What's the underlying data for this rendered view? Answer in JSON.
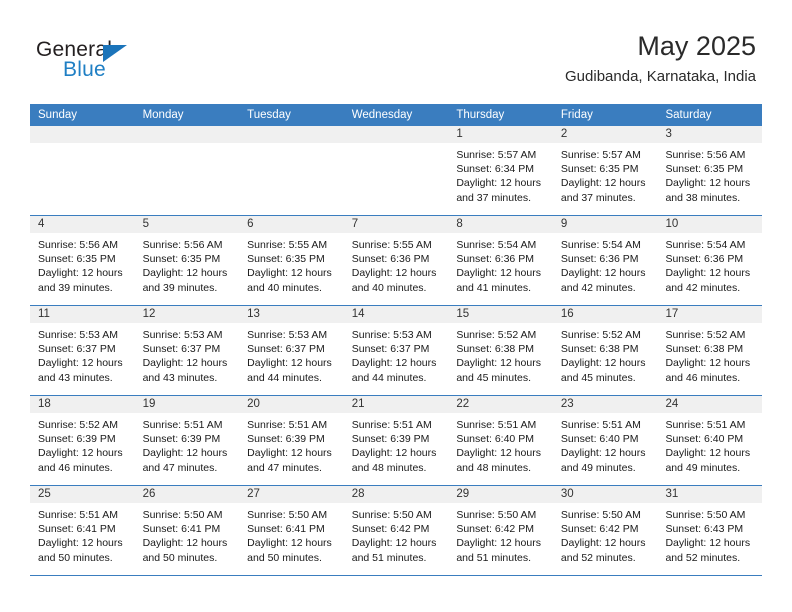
{
  "brand": {
    "name_top": "General",
    "name_bottom": "Blue",
    "accent_color": "#1b74ba",
    "logo_icon": "triangle-logo-icon"
  },
  "header": {
    "title": "May 2025",
    "subtitle": "Gudibanda, Karnataka, India"
  },
  "calendar": {
    "header_bg": "#3a7dbf",
    "day_band_bg": "#f0f0f0",
    "weekdays": [
      "Sunday",
      "Monday",
      "Tuesday",
      "Wednesday",
      "Thursday",
      "Friday",
      "Saturday"
    ],
    "weeks": [
      [
        {
          "day": "",
          "lines": []
        },
        {
          "day": "",
          "lines": []
        },
        {
          "day": "",
          "lines": []
        },
        {
          "day": "",
          "lines": []
        },
        {
          "day": "1",
          "lines": [
            "Sunrise: 5:57 AM",
            "Sunset: 6:34 PM",
            "Daylight: 12 hours",
            "and 37 minutes."
          ]
        },
        {
          "day": "2",
          "lines": [
            "Sunrise: 5:57 AM",
            "Sunset: 6:35 PM",
            "Daylight: 12 hours",
            "and 37 minutes."
          ]
        },
        {
          "day": "3",
          "lines": [
            "Sunrise: 5:56 AM",
            "Sunset: 6:35 PM",
            "Daylight: 12 hours",
            "and 38 minutes."
          ]
        }
      ],
      [
        {
          "day": "4",
          "lines": [
            "Sunrise: 5:56 AM",
            "Sunset: 6:35 PM",
            "Daylight: 12 hours",
            "and 39 minutes."
          ]
        },
        {
          "day": "5",
          "lines": [
            "Sunrise: 5:56 AM",
            "Sunset: 6:35 PM",
            "Daylight: 12 hours",
            "and 39 minutes."
          ]
        },
        {
          "day": "6",
          "lines": [
            "Sunrise: 5:55 AM",
            "Sunset: 6:35 PM",
            "Daylight: 12 hours",
            "and 40 minutes."
          ]
        },
        {
          "day": "7",
          "lines": [
            "Sunrise: 5:55 AM",
            "Sunset: 6:36 PM",
            "Daylight: 12 hours",
            "and 40 minutes."
          ]
        },
        {
          "day": "8",
          "lines": [
            "Sunrise: 5:54 AM",
            "Sunset: 6:36 PM",
            "Daylight: 12 hours",
            "and 41 minutes."
          ]
        },
        {
          "day": "9",
          "lines": [
            "Sunrise: 5:54 AM",
            "Sunset: 6:36 PM",
            "Daylight: 12 hours",
            "and 42 minutes."
          ]
        },
        {
          "day": "10",
          "lines": [
            "Sunrise: 5:54 AM",
            "Sunset: 6:36 PM",
            "Daylight: 12 hours",
            "and 42 minutes."
          ]
        }
      ],
      [
        {
          "day": "11",
          "lines": [
            "Sunrise: 5:53 AM",
            "Sunset: 6:37 PM",
            "Daylight: 12 hours",
            "and 43 minutes."
          ]
        },
        {
          "day": "12",
          "lines": [
            "Sunrise: 5:53 AM",
            "Sunset: 6:37 PM",
            "Daylight: 12 hours",
            "and 43 minutes."
          ]
        },
        {
          "day": "13",
          "lines": [
            "Sunrise: 5:53 AM",
            "Sunset: 6:37 PM",
            "Daylight: 12 hours",
            "and 44 minutes."
          ]
        },
        {
          "day": "14",
          "lines": [
            "Sunrise: 5:53 AM",
            "Sunset: 6:37 PM",
            "Daylight: 12 hours",
            "and 44 minutes."
          ]
        },
        {
          "day": "15",
          "lines": [
            "Sunrise: 5:52 AM",
            "Sunset: 6:38 PM",
            "Daylight: 12 hours",
            "and 45 minutes."
          ]
        },
        {
          "day": "16",
          "lines": [
            "Sunrise: 5:52 AM",
            "Sunset: 6:38 PM",
            "Daylight: 12 hours",
            "and 45 minutes."
          ]
        },
        {
          "day": "17",
          "lines": [
            "Sunrise: 5:52 AM",
            "Sunset: 6:38 PM",
            "Daylight: 12 hours",
            "and 46 minutes."
          ]
        }
      ],
      [
        {
          "day": "18",
          "lines": [
            "Sunrise: 5:52 AM",
            "Sunset: 6:39 PM",
            "Daylight: 12 hours",
            "and 46 minutes."
          ]
        },
        {
          "day": "19",
          "lines": [
            "Sunrise: 5:51 AM",
            "Sunset: 6:39 PM",
            "Daylight: 12 hours",
            "and 47 minutes."
          ]
        },
        {
          "day": "20",
          "lines": [
            "Sunrise: 5:51 AM",
            "Sunset: 6:39 PM",
            "Daylight: 12 hours",
            "and 47 minutes."
          ]
        },
        {
          "day": "21",
          "lines": [
            "Sunrise: 5:51 AM",
            "Sunset: 6:39 PM",
            "Daylight: 12 hours",
            "and 48 minutes."
          ]
        },
        {
          "day": "22",
          "lines": [
            "Sunrise: 5:51 AM",
            "Sunset: 6:40 PM",
            "Daylight: 12 hours",
            "and 48 minutes."
          ]
        },
        {
          "day": "23",
          "lines": [
            "Sunrise: 5:51 AM",
            "Sunset: 6:40 PM",
            "Daylight: 12 hours",
            "and 49 minutes."
          ]
        },
        {
          "day": "24",
          "lines": [
            "Sunrise: 5:51 AM",
            "Sunset: 6:40 PM",
            "Daylight: 12 hours",
            "and 49 minutes."
          ]
        }
      ],
      [
        {
          "day": "25",
          "lines": [
            "Sunrise: 5:51 AM",
            "Sunset: 6:41 PM",
            "Daylight: 12 hours",
            "and 50 minutes."
          ]
        },
        {
          "day": "26",
          "lines": [
            "Sunrise: 5:50 AM",
            "Sunset: 6:41 PM",
            "Daylight: 12 hours",
            "and 50 minutes."
          ]
        },
        {
          "day": "27",
          "lines": [
            "Sunrise: 5:50 AM",
            "Sunset: 6:41 PM",
            "Daylight: 12 hours",
            "and 50 minutes."
          ]
        },
        {
          "day": "28",
          "lines": [
            "Sunrise: 5:50 AM",
            "Sunset: 6:42 PM",
            "Daylight: 12 hours",
            "and 51 minutes."
          ]
        },
        {
          "day": "29",
          "lines": [
            "Sunrise: 5:50 AM",
            "Sunset: 6:42 PM",
            "Daylight: 12 hours",
            "and 51 minutes."
          ]
        },
        {
          "day": "30",
          "lines": [
            "Sunrise: 5:50 AM",
            "Sunset: 6:42 PM",
            "Daylight: 12 hours",
            "and 52 minutes."
          ]
        },
        {
          "day": "31",
          "lines": [
            "Sunrise: 5:50 AM",
            "Sunset: 6:43 PM",
            "Daylight: 12 hours",
            "and 52 minutes."
          ]
        }
      ]
    ]
  }
}
